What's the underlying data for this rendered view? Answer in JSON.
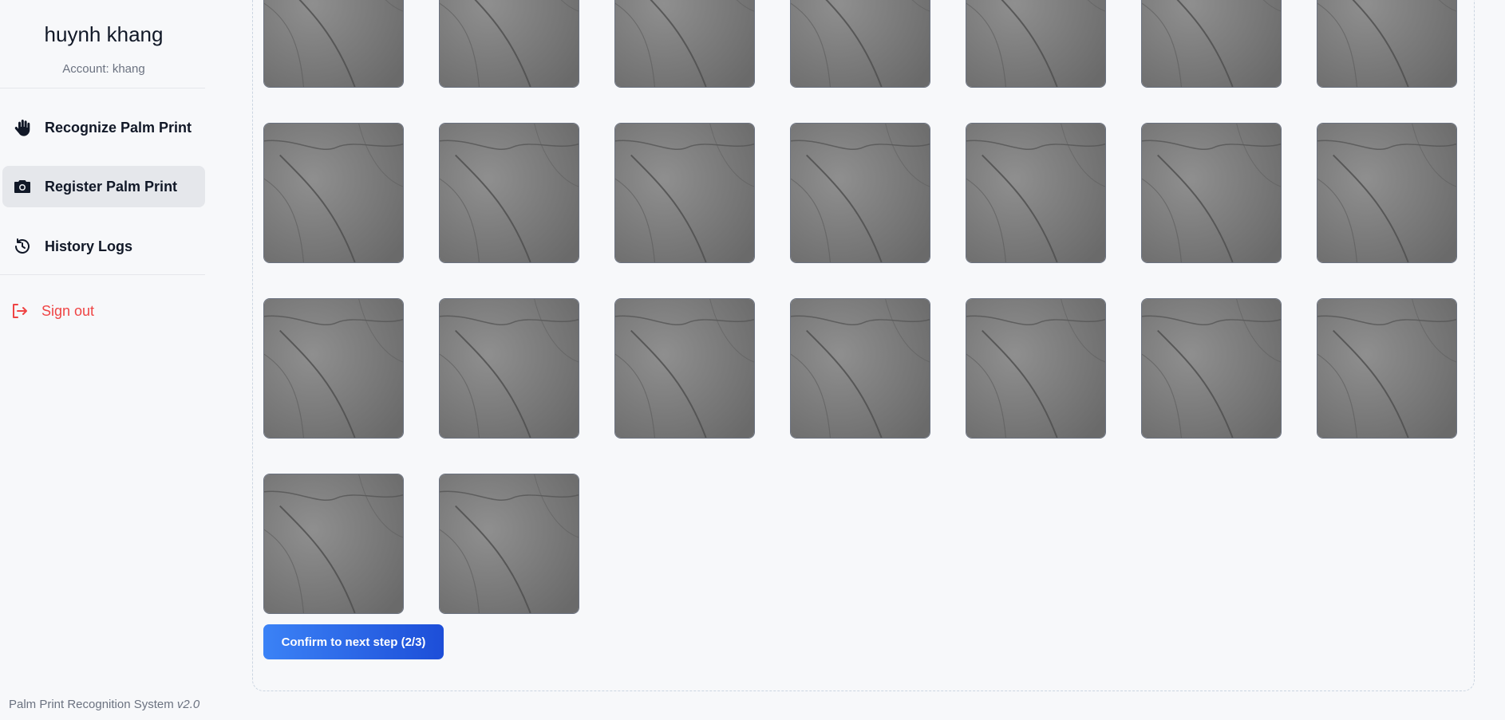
{
  "sidebar": {
    "user_name": "huynh khang",
    "account": "Account: khang",
    "nav": [
      {
        "label": "Recognize Palm Print",
        "icon": "hand-icon"
      },
      {
        "label": "Register Palm Print",
        "icon": "camera-icon",
        "active": true
      },
      {
        "label": "History Logs",
        "icon": "history-icon"
      }
    ],
    "sign_out": {
      "label": "Sign out",
      "icon": "sign-out-icon"
    },
    "footer": {
      "name": "Palm Print Recognition System",
      "version": "v2.0"
    }
  },
  "main": {
    "captured_image_count": 23,
    "confirm_label": "Confirm to next step (2/3)"
  },
  "colors": {
    "accent_start": "#3b82f6",
    "accent_end": "#1d4ed8",
    "danger": "#ef4444",
    "active_nav_bg": "#e5e7eb"
  }
}
